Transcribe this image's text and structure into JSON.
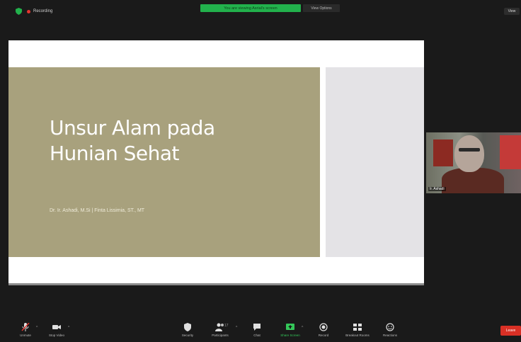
{
  "topbar": {
    "recording_label": "Recording",
    "share_banner": "You are viewing Asrial's screen",
    "view_options": "View Options",
    "view_button": "View"
  },
  "slide": {
    "title_line1": "Unsur Alam pada",
    "title_line2": "Hunian Sehat",
    "subtitle": "Dr. Ir. Ashadi, M.Si | Finta Lissimia, ST., MT"
  },
  "video": {
    "participant_name": "Ir. Ashadi"
  },
  "toolbar": {
    "unmute": "Unmute",
    "stop_video": "Stop Video",
    "security": "Security",
    "participants": "Participants",
    "participants_count": "17",
    "chat": "Chat",
    "share_screen": "Share Screen",
    "record": "Record",
    "breakout_rooms": "Breakout Rooms",
    "reactions": "Reactions",
    "end": "Leave"
  },
  "colors": {
    "slide_bg": "#a8a17d",
    "share_green": "#22b14c",
    "end_red": "#d93025"
  }
}
